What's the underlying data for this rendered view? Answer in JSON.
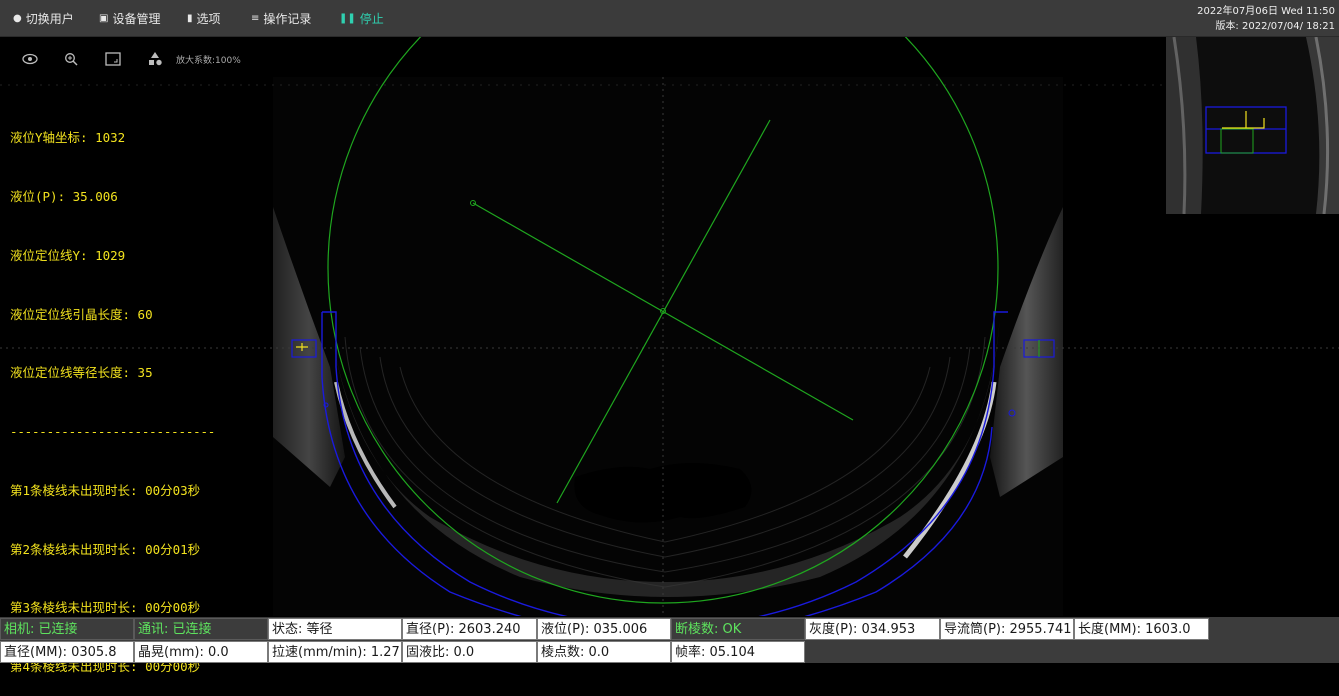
{
  "menu": {
    "switch_user": "切换用户",
    "device_mgmt": "设备管理",
    "options": "选项",
    "op_log": "操作记录",
    "stop": "停止",
    "icons": [
      "user-icon",
      "device-icon",
      "options-icon",
      "list-icon",
      "pause-icon"
    ]
  },
  "clock": {
    "datetime": "2022年07月06日 Wed 11:50",
    "version": "版本: 2022/07/04/ 18:21"
  },
  "view_toolbar": {
    "icons": [
      "eye-icon",
      "zoom-icon",
      "fit-icon",
      "shapes-icon"
    ],
    "zoom_label": "放大系数:100%"
  },
  "overlay": {
    "lines": [
      "液位Y轴坐标: 1032",
      "液位(P): 35.006",
      "液位定位线Y: 1029",
      "液位定位线引晶长度: 60",
      "液位定位线等径长度: 35",
      "----------------------------",
      "第1条棱线未出现时长: 00分03秒",
      "第2条棱线未出现时长: 00分01秒",
      "第3条棱线未出现时长: 00分00秒",
      "第4条棱线未出现时长: 00分00秒"
    ],
    "color": "#f2e21e"
  },
  "colors": {
    "overlay_green": "#1fa61f",
    "overlay_blue": "#1a1add",
    "stop_accent": "#2fd0b0",
    "status_ok_green": "#5ee35e"
  },
  "status": {
    "row1": [
      "相机: 已连接",
      "通讯: 已连接",
      "状态: 等径",
      "直径(P): 2603.240",
      "液位(P): 035.006",
      "断棱数: OK",
      "灰度(P): 034.953",
      "导流筒(P): 2955.741",
      "长度(MM): 1603.0"
    ],
    "row2": [
      "直径(MM): 0305.8",
      "晶晃(mm): 0.0",
      "拉速(mm/min): 1.27",
      "固液比: 0.0",
      "棱点数: 0.0",
      "帧率: 05.104"
    ]
  }
}
